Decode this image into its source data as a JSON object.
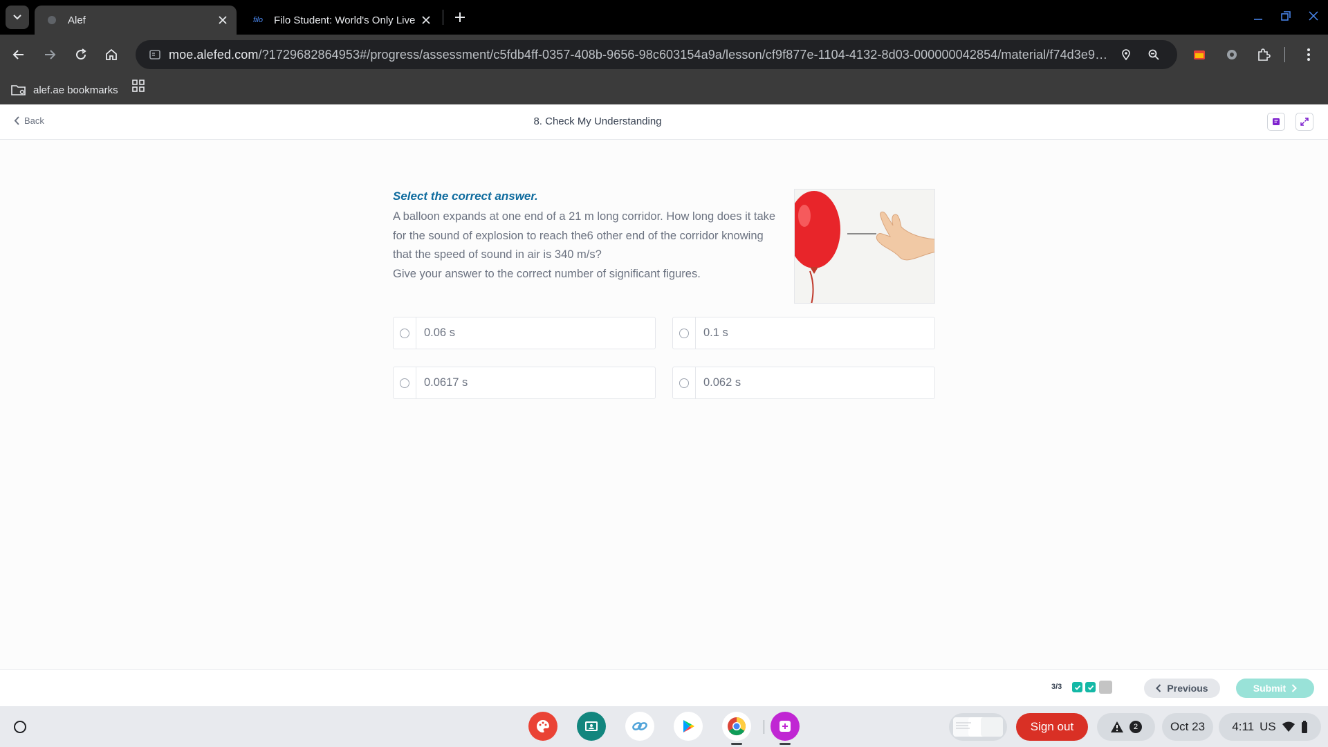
{
  "browser": {
    "tabs": [
      {
        "title": "Alef",
        "active": true
      },
      {
        "title": "Filo Student: World's Only Live I",
        "favicon_text": "filo",
        "active": false
      }
    ],
    "url_host": "moe.alefed.com",
    "url_path": "/?1729682864953#/progress/assessment/c5fdb4ff-0357-408b-9656-98c603154a9a/lesson/cf9f877e-1104-4132-8d03-000000042854/material/f74d3e9a-ae...",
    "bookmark_folder": "alef.ae bookmarks"
  },
  "header": {
    "back_label": "Back",
    "title": "8. Check My Understanding"
  },
  "question": {
    "instruction": "Select the correct answer.",
    "text_line1": "A balloon expands at one end of a 21 m long corridor. How long does it take",
    "text_line2": "for the sound of explosion to reach the6 other end of the corridor knowing",
    "text_line3": "that the speed of sound in air is 340 m/s?",
    "text_line4": "Give your answer to the correct number of significant figures.",
    "options": [
      {
        "label": "0.06 s"
      },
      {
        "label": "0.1 s"
      },
      {
        "label": "0.0617 s"
      },
      {
        "label": "0.062 s"
      }
    ]
  },
  "footer": {
    "progress": "3/3",
    "previous_label": "Previous",
    "submit_label": "Submit"
  },
  "shelf": {
    "signout_label": "Sign out",
    "notification_count": "2",
    "date": "Oct 23",
    "time": "4:11",
    "locale": "US"
  },
  "colors": {
    "accent_teal": "#14b8a6",
    "instruction_blue": "#0e6b9e",
    "signout_red": "#d93025",
    "submit_disabled": "#99e2d8"
  }
}
